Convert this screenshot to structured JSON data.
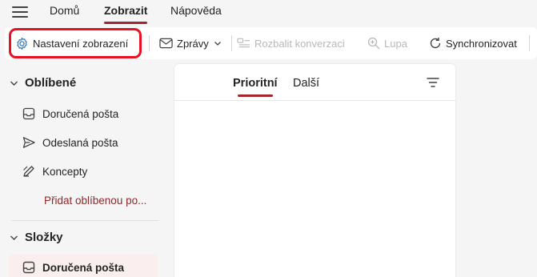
{
  "menu": {
    "hamburger_icon": "hamburger-menu-icon",
    "tabs": [
      {
        "label": "Domů",
        "active": false
      },
      {
        "label": "Zobrazit",
        "active": true
      },
      {
        "label": "Nápověda",
        "active": false
      }
    ]
  },
  "toolbar": {
    "view_settings_label": "Nastavení zobrazení",
    "messages_label": "Zprávy",
    "expand_conversation_label": "Rozbalit konverzaci",
    "zoom_label": "Lupa",
    "sync_label": "Synchronizovat"
  },
  "sidebar": {
    "favorites_title": "Oblíbené",
    "favorites": [
      {
        "label": "Doručená pošta",
        "icon": "inbox-icon"
      },
      {
        "label": "Odeslaná pošta",
        "icon": "send-icon"
      },
      {
        "label": "Koncepty",
        "icon": "drafts-icon"
      }
    ],
    "add_favorite_label": "Přidat oblíbenou po...",
    "folders_title": "Složky",
    "folders": [
      {
        "label": "Doručená pošta",
        "icon": "inbox-icon",
        "selected": true
      }
    ]
  },
  "message_list": {
    "tabs": [
      {
        "label": "Prioritní",
        "active": true
      },
      {
        "label": "Další",
        "active": false
      }
    ],
    "filter_icon": "filter-icon"
  },
  "colors": {
    "accent": "#a4262c",
    "highlight_box": "#e81123",
    "link": "#8a2a2a",
    "disabled": "#b8b8b8"
  }
}
